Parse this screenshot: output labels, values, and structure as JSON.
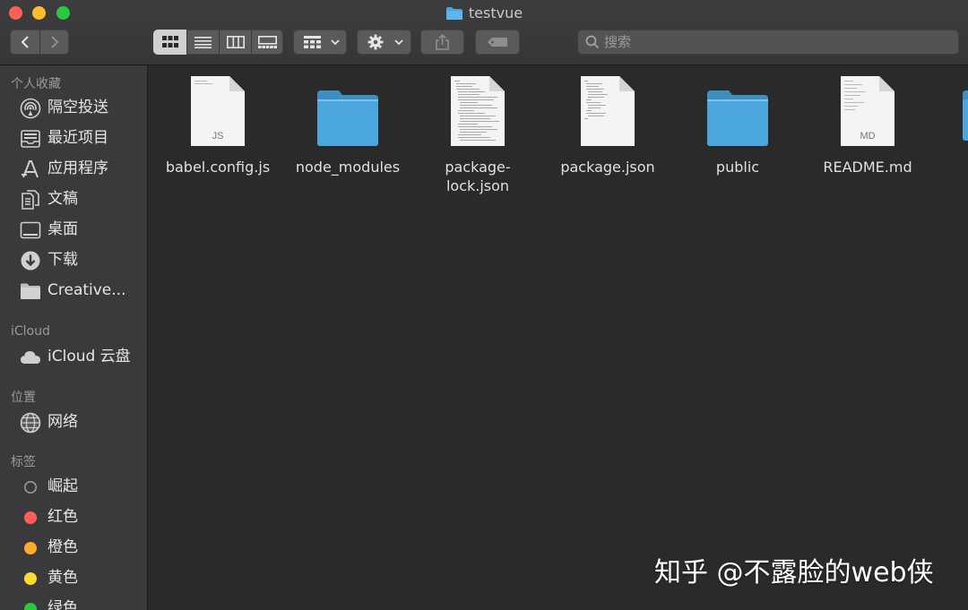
{
  "window": {
    "title": "testvue"
  },
  "toolbar": {
    "search_placeholder": "搜索"
  },
  "sidebar": {
    "favorites_header": "个人收藏",
    "favorites": [
      {
        "label": "隔空投送",
        "icon": "airdrop-icon"
      },
      {
        "label": "最近项目",
        "icon": "recents-icon"
      },
      {
        "label": "应用程序",
        "icon": "applications-icon"
      },
      {
        "label": "文稿",
        "icon": "documents-icon"
      },
      {
        "label": "桌面",
        "icon": "desktop-icon"
      },
      {
        "label": "下载",
        "icon": "downloads-icon"
      },
      {
        "label": "Creative...",
        "icon": "folder-icon"
      }
    ],
    "icloud_header": "iCloud",
    "icloud": [
      {
        "label": "iCloud 云盘",
        "icon": "cloud-icon"
      }
    ],
    "locations_header": "位置",
    "locations": [
      {
        "label": "网络",
        "icon": "network-icon"
      }
    ],
    "tags_header": "标签",
    "tags": [
      {
        "label": "崛起",
        "color": "#3a3a3c"
      },
      {
        "label": "红色",
        "color": "#fe5f57"
      },
      {
        "label": "橙色",
        "color": "#fdab2b"
      },
      {
        "label": "黄色",
        "color": "#fdd932"
      },
      {
        "label": "绿色",
        "color": "#28c840"
      }
    ]
  },
  "files": [
    {
      "name": "babel.config.js",
      "kind": "document",
      "badge": "JS"
    },
    {
      "name": "node_modules",
      "kind": "folder"
    },
    {
      "name": "package-\nlock.json",
      "kind": "document-text"
    },
    {
      "name": "package.json",
      "kind": "document-text"
    },
    {
      "name": "public",
      "kind": "folder"
    },
    {
      "name": "README.md",
      "kind": "document",
      "badge": "MD"
    }
  ],
  "watermark": "知乎 @不露脸的web侠",
  "colors": {
    "folder": "#4aa6dc",
    "folder_tab": "#3d8fc2"
  }
}
